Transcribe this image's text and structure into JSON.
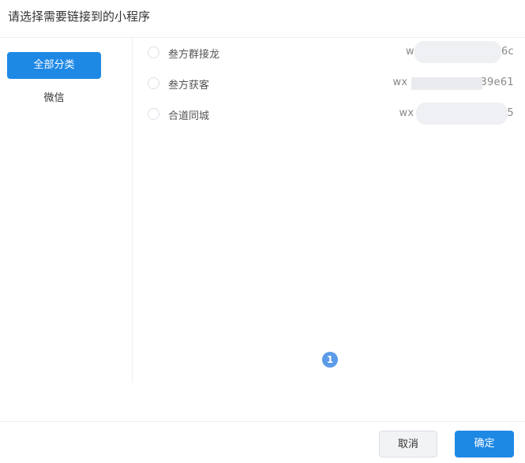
{
  "dialog": {
    "title": "请选择需要链接到的小程序"
  },
  "sidebar": {
    "items": [
      {
        "label": "全部分类",
        "active": true
      },
      {
        "label": "微信",
        "active": false
      }
    ]
  },
  "list": {
    "rows": [
      {
        "name": "叁方群接龙",
        "appid_prefix": "w",
        "appid_suffix": "6c"
      },
      {
        "name": "叁方获客",
        "appid_prefix": "wx",
        "appid_suffix": "39e61"
      },
      {
        "name": "合道同城",
        "appid_prefix": "wx",
        "appid_suffix": "5"
      }
    ]
  },
  "pagination": {
    "current_page": "1"
  },
  "footer": {
    "cancel_label": "取消",
    "confirm_label": "确定"
  },
  "colors": {
    "primary": "#1e88e5",
    "pager": "#5b9be8",
    "border": "#ebeef5"
  }
}
